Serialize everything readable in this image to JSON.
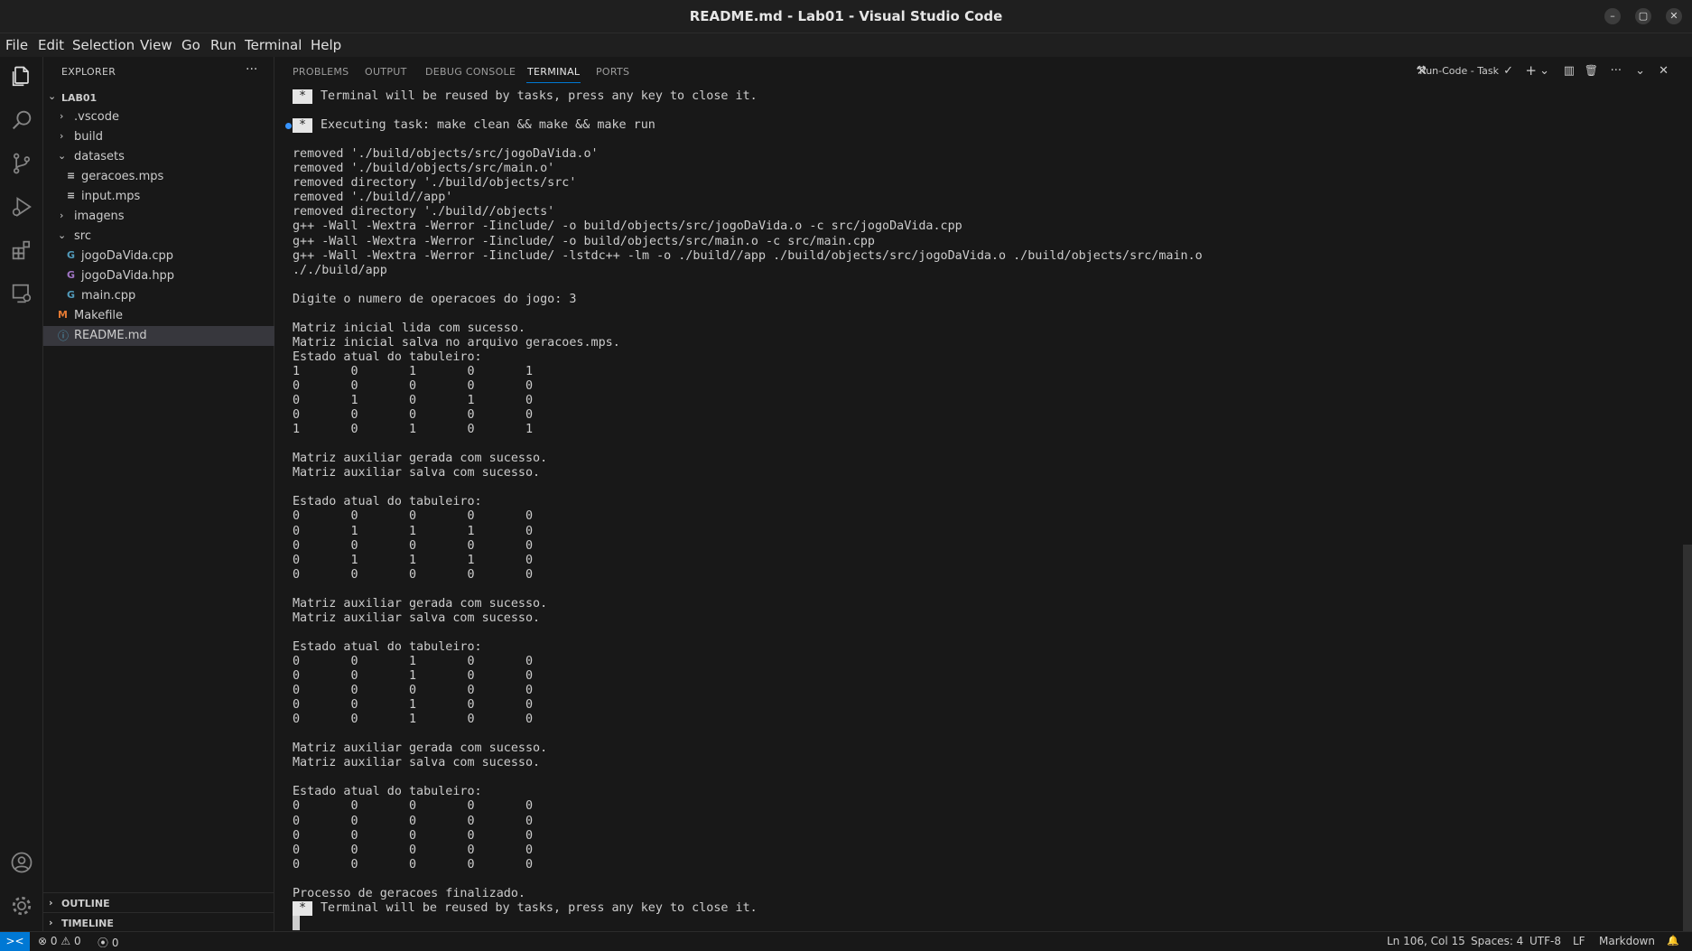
{
  "window": {
    "title": "README.md - Lab01 - Visual Studio Code",
    "minimize": "–",
    "maximize": "▢",
    "close": "✕"
  },
  "menu": [
    "File",
    "Edit",
    "Selection",
    "View",
    "Go",
    "Run",
    "Terminal",
    "Help"
  ],
  "activity_bar": [
    "files-icon",
    "search-icon",
    "source-control-icon",
    "run-debug-icon",
    "extensions-icon",
    "remote-explorer-icon",
    "account-icon",
    "settings-gear-icon"
  ],
  "explorer": {
    "title": "EXPLORER",
    "more": "···",
    "root": "LAB01",
    "items": [
      {
        "label": ".vscode",
        "type": "folder",
        "expanded": false,
        "indent": 1
      },
      {
        "label": "build",
        "type": "folder",
        "expanded": false,
        "indent": 1
      },
      {
        "label": "datasets",
        "type": "folder",
        "expanded": true,
        "indent": 1
      },
      {
        "label": "geracoes.mps",
        "type": "file",
        "icon": "≡",
        "indent": 2
      },
      {
        "label": "input.mps",
        "type": "file",
        "icon": "≡",
        "indent": 2
      },
      {
        "label": "imagens",
        "type": "folder",
        "expanded": false,
        "indent": 1
      },
      {
        "label": "src",
        "type": "folder",
        "expanded": true,
        "indent": 1
      },
      {
        "label": "jogoDaVida.cpp",
        "type": "file",
        "icon": "G",
        "indent": 2
      },
      {
        "label": "jogoDaVida.hpp",
        "type": "file",
        "icon": "G",
        "indent": 2
      },
      {
        "label": "main.cpp",
        "type": "file",
        "icon": "G",
        "indent": 2
      },
      {
        "label": "Makefile",
        "type": "file",
        "icon": "M",
        "indent": 1
      },
      {
        "label": "README.md",
        "type": "file",
        "icon": "ⓘ",
        "indent": 1,
        "selected": true
      }
    ],
    "sections": [
      "OUTLINE",
      "TIMELINE"
    ]
  },
  "panel": {
    "tabs": [
      "PROBLEMS",
      "OUTPUT",
      "DEBUG CONSOLE",
      "TERMINAL",
      "PORTS"
    ],
    "active_tab": "TERMINAL",
    "task_label": "Run-Code - Task",
    "actions": [
      "✓",
      "+",
      "⌄",
      "▥",
      "🗑",
      "···",
      "⌄",
      "✕"
    ]
  },
  "terminal": {
    "lines": [
      "* Terminal will be reused by tasks, press any key to close it.",
      "",
      "* Executing task: make clean && make && make run",
      "",
      "removed './build/objects/src/jogoDaVida.o'",
      "removed './build/objects/src/main.o'",
      "removed directory './build/objects/src'",
      "removed './build//app'",
      "removed directory './build//objects'",
      "g++ -Wall -Wextra -Werror -Iinclude/ -o build/objects/src/jogoDaVida.o -c src/jogoDaVida.cpp",
      "g++ -Wall -Wextra -Werror -Iinclude/ -o build/objects/src/main.o -c src/main.cpp",
      "g++ -Wall -Wextra -Werror -Iinclude/ -lstdc++ -lm -o ./build//app ./build/objects/src/jogoDaVida.o ./build/objects/src/main.o",
      "././build/app",
      "",
      "Digite o numero de operacoes do jogo: 3",
      "",
      "Matriz inicial lida com sucesso.",
      "Matriz inicial salva no arquivo geracoes.mps.",
      "Estado atual do tabuleiro:",
      "1       0       1       0       1",
      "0       0       0       0       0",
      "0       1       0       1       0",
      "0       0       0       0       0",
      "1       0       1       0       1",
      "",
      "Matriz auxiliar gerada com sucesso.",
      "Matriz auxiliar salva com sucesso.",
      "",
      "Estado atual do tabuleiro:",
      "0       0       0       0       0",
      "0       1       1       1       0",
      "0       0       0       0       0",
      "0       1       1       1       0",
      "0       0       0       0       0",
      "",
      "Matriz auxiliar gerada com sucesso.",
      "Matriz auxiliar salva com sucesso.",
      "",
      "Estado atual do tabuleiro:",
      "0       0       1       0       0",
      "0       0       1       0       0",
      "0       0       0       0       0",
      "0       0       1       0       0",
      "0       0       1       0       0",
      "",
      "Matriz auxiliar gerada com sucesso.",
      "Matriz auxiliar salva com sucesso.",
      "",
      "Estado atual do tabuleiro:",
      "0       0       0       0       0",
      "0       0       0       0       0",
      "0       0       0       0       0",
      "0       0       0       0       0",
      "0       0       0       0       0",
      "",
      "Processo de geracoes finalizado.",
      "* Terminal will be reused by tasks, press any key to close it."
    ]
  },
  "status_bar": {
    "remote": "><",
    "errors": "0",
    "warnings": "0",
    "ports": "0",
    "position": "Ln 106, Col 15",
    "spaces": "Spaces: 4",
    "encoding": "UTF-8",
    "eol": "LF",
    "language": "Markdown",
    "bell": "🔔"
  },
  "colors": {
    "accent": "#0078d4",
    "makefile_icon": "#e37933",
    "cpp_icon": "#519aba",
    "hpp_icon": "#a074c4",
    "readme_icon": "#519aba"
  }
}
